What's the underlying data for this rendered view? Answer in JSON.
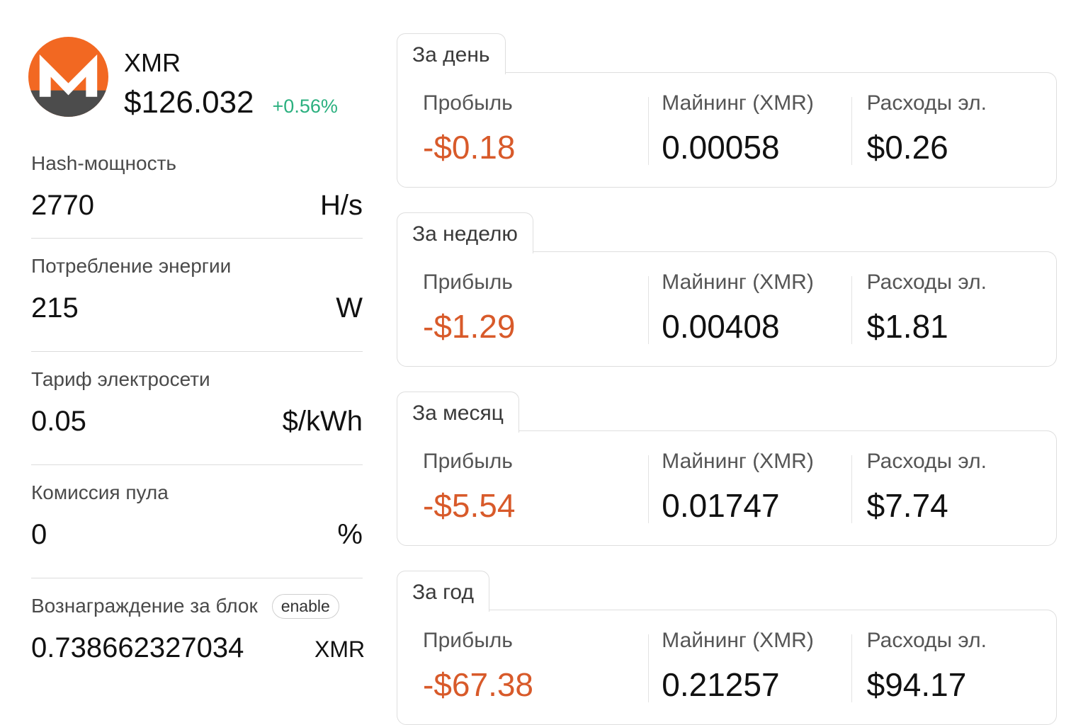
{
  "coin": {
    "symbol": "XMR",
    "price": "$126.032",
    "change": "+0.56%",
    "logo_icon": "monero-logo-icon",
    "colors": {
      "logo_orange": "#f26822",
      "logo_gray": "#4c4c4c",
      "change_positive": "#2bb07f",
      "profit_negative": "#d85a2a"
    }
  },
  "inputs": [
    {
      "label": "Hash-мощность",
      "value": "2770",
      "unit": "H/s"
    },
    {
      "label": "Потребление энергии",
      "value": "215",
      "unit": "W"
    },
    {
      "label": "Тариф электросети",
      "value": "0.05",
      "unit": "$/kWh"
    },
    {
      "label": "Комиссия пула",
      "value": "0",
      "unit": "%"
    },
    {
      "label": "Вознаграждение за блок",
      "value": "0.738662327034",
      "unit": "XMR",
      "toggle_label": "enable"
    }
  ],
  "periods": [
    {
      "tab": "За день",
      "profit_label": "Пробыль",
      "profit": "-$0.18",
      "mining_label": "Майнинг (XMR)",
      "mining": "0.00058",
      "cost_label": "Расходы эл.",
      "cost": "$0.26"
    },
    {
      "tab": "За неделю",
      "profit_label": "Прибыль",
      "profit": "-$1.29",
      "mining_label": "Майнинг (XMR)",
      "mining": "0.00408",
      "cost_label": "Расходы эл.",
      "cost": "$1.81"
    },
    {
      "tab": "За месяц",
      "profit_label": "Прибыль",
      "profit": "-$5.54",
      "mining_label": "Майнинг (XMR)",
      "mining": "0.01747",
      "cost_label": "Расходы эл.",
      "cost": "$7.74"
    },
    {
      "tab": "За год",
      "profit_label": "Прибыль",
      "profit": "-$67.38",
      "mining_label": "Майнинг (XMR)",
      "mining": "0.21257",
      "cost_label": "Расходы эл.",
      "cost": "$94.17"
    }
  ]
}
